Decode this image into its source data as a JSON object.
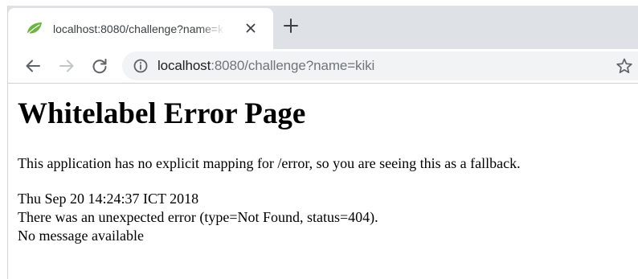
{
  "browser": {
    "tab": {
      "title": "localhost:8080/challenge?name=kiki",
      "favicon": "spring-leaf-icon",
      "favicon_color": "#6db33f",
      "close_icon": "close-icon"
    },
    "new_tab_icon": "plus-icon",
    "toolbar": {
      "back_icon": "back-arrow-icon",
      "forward_icon": "forward-arrow-icon",
      "reload_icon": "reload-icon",
      "site_info_icon": "info-icon",
      "bookmark_icon": "star-icon"
    },
    "address_bar": {
      "host": "localhost",
      "rest": ":8080/challenge?name=kiki"
    },
    "colors": {
      "tab_strip": "#dee1e6",
      "omnibox": "#f1f3f4"
    }
  },
  "page": {
    "heading": "Whitelabel Error Page",
    "description": "This application has no explicit mapping for /error, so you are seeing this as a fallback.",
    "timestamp": "Thu Sep 20 14:24:37 ICT 2018",
    "error_line": "There was an unexpected error (type=Not Found, status=404).",
    "message": "No message available"
  }
}
